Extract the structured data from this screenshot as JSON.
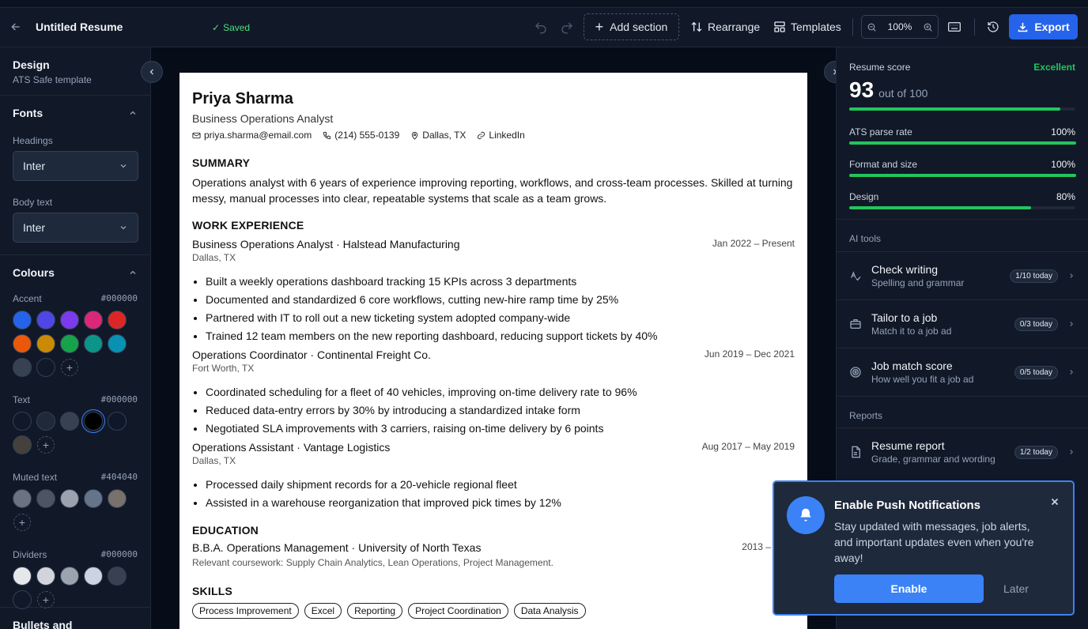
{
  "header": {
    "title": "Untitled Resume",
    "saved": "Saved",
    "add_section": "Add section",
    "rearrange": "Rearrange",
    "templates": "Templates",
    "zoom": "100%",
    "export": "Export"
  },
  "left": {
    "design_title": "Design",
    "design_sub": "ATS Safe template",
    "fonts_title": "Fonts",
    "headings_label": "Headings",
    "headings_value": "Inter",
    "body_label": "Body text",
    "body_value": "Inter",
    "colours_title": "Colours",
    "accent_label": "Accent",
    "accent_hex": "#000000",
    "text_label": "Text",
    "text_hex": "#000000",
    "muted_label": "Muted text",
    "muted_hex": "#404040",
    "dividers_label": "Dividers",
    "dividers_hex": "#000000",
    "bullets_title": "Bullets and",
    "accent_colors": [
      "#2563eb",
      "#4f46e5",
      "#7c3aed",
      "#db2777",
      "#dc2626",
      "#ea580c",
      "#ca8a04",
      "#16a34a",
      "#0d9488",
      "#0891b2",
      "#374151",
      "#111827"
    ],
    "text_colors": [
      "#111827",
      "#1f2937",
      "#374151",
      "#000000",
      "#0f172a",
      "#44403c"
    ],
    "muted_colors": [
      "#6b7280",
      "#4b5563",
      "#9ca3af",
      "#64748b",
      "#78716c"
    ],
    "divider_colors": [
      "#e5e7eb",
      "#d1d5db",
      "#9ca3af",
      "#cbd5e1",
      "#374151",
      "#111827"
    ]
  },
  "resume": {
    "name": "Priya Sharma",
    "role": "Business Operations Analyst",
    "email": "priya.sharma@email.com",
    "phone": "(214) 555-0139",
    "location": "Dallas, TX",
    "linkedin": "LinkedIn",
    "summary_h": "SUMMARY",
    "summary": "Operations analyst with 6 years of experience improving reporting, workflows, and cross-team processes. Skilled at turning messy, manual processes into clear, repeatable systems that scale as a team grows.",
    "work_h": "WORK EXPERIENCE",
    "jobs": [
      {
        "title": "Business Operations Analyst · Halstead Manufacturing",
        "dates": "Jan 2022 – Present",
        "location": "Dallas, TX",
        "bullets": [
          "Built a weekly operations dashboard tracking 15 KPIs across 3 departments",
          "Documented and standardized 6 core workflows, cutting new-hire ramp time by 25%",
          "Partnered with IT to roll out a new ticketing system adopted company-wide",
          "Trained 12 team members on the new reporting dashboard, reducing support tickets by 40%"
        ]
      },
      {
        "title": "Operations Coordinator · Continental Freight Co.",
        "dates": "Jun 2019 – Dec 2021",
        "location": "Fort Worth, TX",
        "bullets": [
          "Coordinated scheduling for a fleet of 40 vehicles, improving on-time delivery rate to 96%",
          "Reduced data-entry errors by 30% by introducing a standardized intake form",
          "Negotiated SLA improvements with 3 carriers, raising on-time delivery by 6 points"
        ]
      },
      {
        "title": "Operations Assistant · Vantage Logistics",
        "dates": "Aug 2017 – May 2019",
        "location": "Dallas, TX",
        "bullets": [
          "Processed daily shipment records for a 20-vehicle regional fleet",
          "Assisted in a warehouse reorganization that improved pick times by 12%"
        ]
      }
    ],
    "edu_h": "EDUCATION",
    "edu_title": "B.B.A. Operations Management · University of North Texas",
    "edu_dates": "2013 – 2017",
    "edu_detail": "Relevant coursework: Supply Chain Analytics, Lean Operations, Project Management.",
    "skills_h": "SKILLS",
    "skills": [
      "Process Improvement",
      "Excel",
      "Reporting",
      "Project Coordination",
      "Data Analysis"
    ]
  },
  "score": {
    "label": "Resume score",
    "rating": "Excellent",
    "value": "93",
    "out_of": "out of 100",
    "fraction": 0.93,
    "metrics": [
      {
        "label": "ATS parse rate",
        "value": "100%",
        "fraction": 1.0
      },
      {
        "label": "Format and size",
        "value": "100%",
        "fraction": 1.0
      },
      {
        "label": "Design",
        "value": "80%",
        "fraction": 0.8
      }
    ]
  },
  "ai_tools": {
    "title": "AI tools",
    "items": [
      {
        "title": "Check writing",
        "sub": "Spelling and grammar",
        "badge": "1/10 today",
        "icon": "spellcheck-icon"
      },
      {
        "title": "Tailor to a job",
        "sub": "Match it to a job ad",
        "badge": "0/3 today",
        "icon": "briefcase-icon"
      },
      {
        "title": "Job match score",
        "sub": "How well you fit a job ad",
        "badge": "0/5 today",
        "icon": "target-icon"
      }
    ]
  },
  "reports": {
    "title": "Reports",
    "items": [
      {
        "title": "Resume report",
        "sub": "Grade, grammar and wording",
        "badge": "1/2 today",
        "icon": "document-icon"
      }
    ]
  },
  "toast": {
    "title": "Enable Push Notifications",
    "text": "Stay updated with messages, job alerts, and important updates even when you're away!",
    "enable": "Enable",
    "later": "Later"
  }
}
